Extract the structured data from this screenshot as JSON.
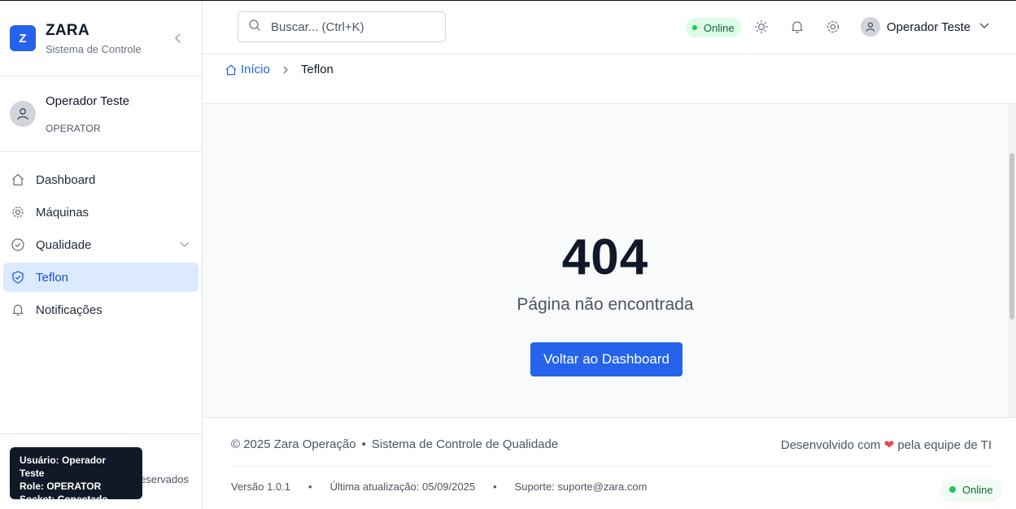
{
  "brand": {
    "logo_letter": "Z",
    "title": "ZARA",
    "subtitle": "Sistema de Controle"
  },
  "user": {
    "name": "Operador Teste",
    "role": "OPERATOR"
  },
  "nav": [
    {
      "label": "Dashboard",
      "icon": "home-icon",
      "active": false
    },
    {
      "label": "Máquinas",
      "icon": "cog-icon",
      "active": false
    },
    {
      "label": "Qualidade",
      "icon": "check-circle-icon",
      "active": false,
      "has_submenu": true
    },
    {
      "label": "Teflon",
      "icon": "shield-check-icon",
      "active": true
    },
    {
      "label": "Notificações",
      "icon": "bell-icon",
      "active": false
    }
  ],
  "sidebar_footer": {
    "rights_text": "eservados"
  },
  "debug_tooltip": {
    "line1": "Usuário: Operador Teste",
    "line2": "Role: OPERATOR",
    "line3": "Socket: Conectado"
  },
  "header": {
    "search_placeholder": "Buscar... (Ctrl+K)",
    "status": "Online",
    "user_name": "Operador Teste"
  },
  "breadcrumb": {
    "home": "Início",
    "current": "Teflon"
  },
  "error": {
    "code": "404",
    "message": "Página não encontrada",
    "button": "Voltar ao Dashboard"
  },
  "footer": {
    "copyright": "© 2025 Zara Operação",
    "system": "Sistema de Controle de Qualidade",
    "dev_prefix": "Desenvolvido com",
    "dev_suffix": "pela equipe de TI",
    "version": "Versão 1.0.1",
    "updated": "Última atualização: 05/09/2025",
    "support": "Suporte: suporte@zara.com",
    "bullet": "•"
  },
  "online_toast": "Online",
  "colors": {
    "accent": "#2563eb",
    "online": "#22c55e",
    "heart": "#ef4444"
  }
}
